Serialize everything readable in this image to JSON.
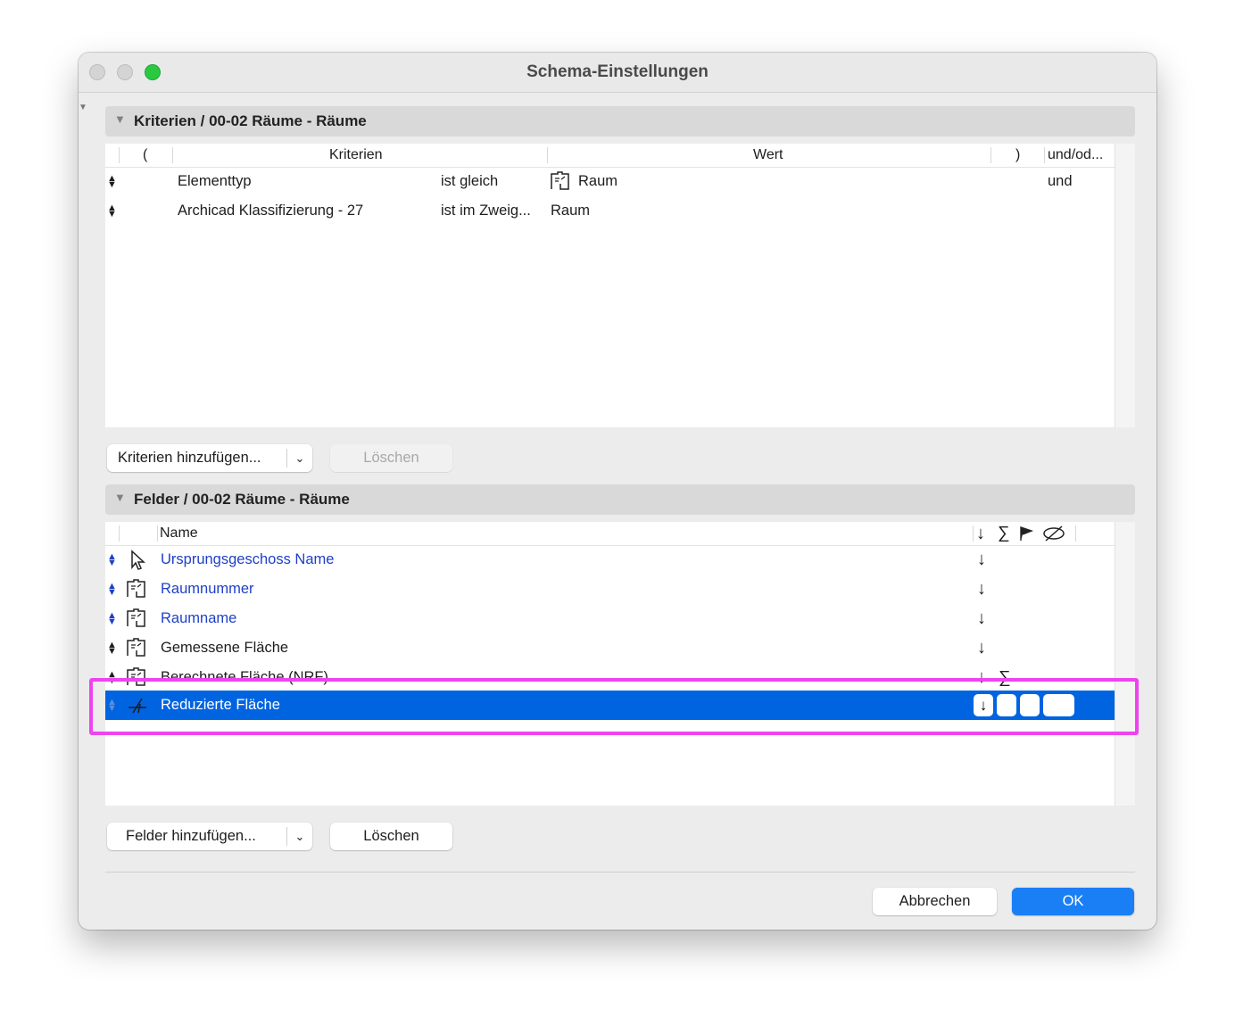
{
  "window": {
    "title": "Schema-Einstellungen"
  },
  "criteria": {
    "section_title": "Kriterien / 00-02 Räume - Räume",
    "headers": {
      "open": "(",
      "criteria": "Kriterien",
      "value": "Wert",
      "close": ")",
      "andor": "und/od..."
    },
    "rows": [
      {
        "criterion": "Elementtyp",
        "operator": "ist gleich",
        "value": "Raum",
        "value_icon": "zone-icon",
        "andor": "und"
      },
      {
        "criterion": "Archicad Klassifizierung - 27",
        "operator": "ist im Zweig...",
        "value": "Raum",
        "andor": ""
      }
    ],
    "add_button": "Kriterien hinzufügen...",
    "delete_button": "Löschen"
  },
  "fields": {
    "section_title": "Felder / 00-02 Räume - Räume",
    "headers": {
      "name": "Name",
      "sort": "↓",
      "sum": "∑"
    },
    "rows": [
      {
        "name": "Ursprungsgeschoss Name",
        "icon": "cursor-arrow-icon",
        "sort": "↓",
        "sum": "",
        "color": "#1f3fc8"
      },
      {
        "name": "Raumnummer",
        "icon": "zone-icon",
        "sort": "↓",
        "sum": "",
        "color": "#1f3fc8"
      },
      {
        "name": "Raumname",
        "icon": "zone-icon",
        "sort": "↓",
        "sum": "",
        "color": "#1f3fc8"
      },
      {
        "name": "Gemessene Fläche",
        "icon": "zone-icon",
        "sort": "↓",
        "sum": "",
        "color": "#1d1d1d"
      },
      {
        "name": "Berechnete Fläche (NRF)",
        "icon": "zone-icon",
        "sort": "↓",
        "sum": "∑",
        "color": "#1d1d1d"
      }
    ],
    "selected_row": {
      "name": "Reduzierte Fläche",
      "icon": "function-icon",
      "sort": "↓"
    },
    "add_button": "Felder hinzufügen...",
    "delete_button": "Löschen"
  },
  "footer": {
    "cancel": "Abbrechen",
    "ok": "OK"
  },
  "colors": {
    "accent": "#1a7ff5",
    "selection": "#0064e1",
    "highlight": "#ee44ee",
    "link_text": "#1f3fc8"
  }
}
